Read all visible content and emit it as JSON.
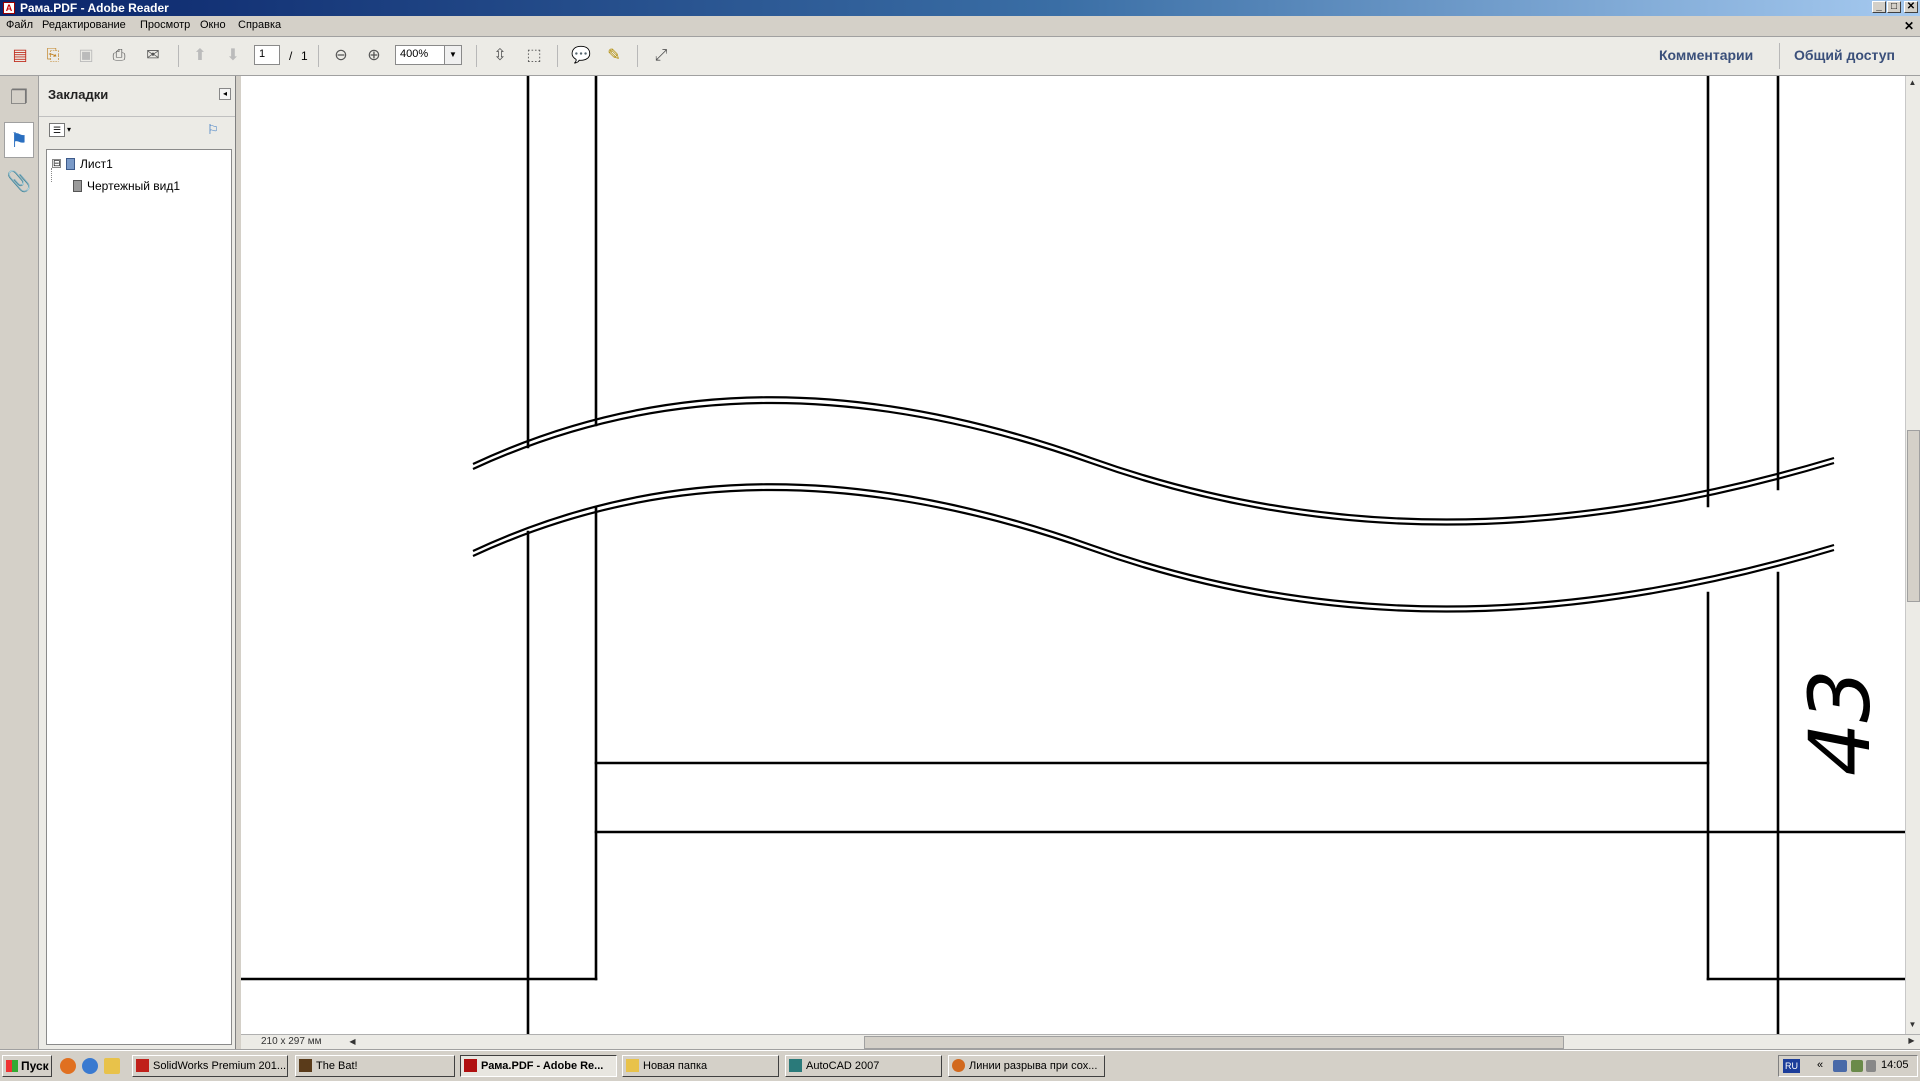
{
  "window": {
    "title": "Рама.PDF - Adobe Reader",
    "controls": [
      "_",
      "□",
      "✕"
    ]
  },
  "menubar": {
    "items": [
      "Файл",
      "Редактирование",
      "Просмотр",
      "Окно",
      "Справка"
    ],
    "close_doc": "✕"
  },
  "toolbar": {
    "current_page": "1",
    "page_separator": "/",
    "total_pages": "1",
    "zoom": "400%",
    "comments_link": "Комментарии",
    "share_link": "Общий доступ"
  },
  "panel": {
    "title": "Закладки",
    "bookmarks": [
      {
        "label": "Лист1",
        "level": 0,
        "expander": "⊟"
      },
      {
        "label": "Чертежный вид1",
        "level": 1
      }
    ]
  },
  "drawing": {
    "dimension_text": "43"
  },
  "status": {
    "page_size": "210 x 297 мм"
  },
  "taskbar": {
    "start_label": "Пуск",
    "tasks": [
      {
        "label": "SolidWorks Premium 201...",
        "icon_color": "#c0201a",
        "active": false
      },
      {
        "label": "The Bat!",
        "icon_color": "#5a3b1a",
        "active": false
      },
      {
        "label": "Рама.PDF - Adobe Re...",
        "icon_color": "#b01010",
        "active": true
      },
      {
        "label": "Новая папка",
        "icon_color": "#e8c24a",
        "active": false
      },
      {
        "label": "AutoCAD 2007",
        "icon_color": "#2a7a7a",
        "active": false
      },
      {
        "label": "Линии разрыва при сох...",
        "icon_color": "#d2691e",
        "active": false
      }
    ],
    "language": "RU",
    "clock": "14:05"
  }
}
